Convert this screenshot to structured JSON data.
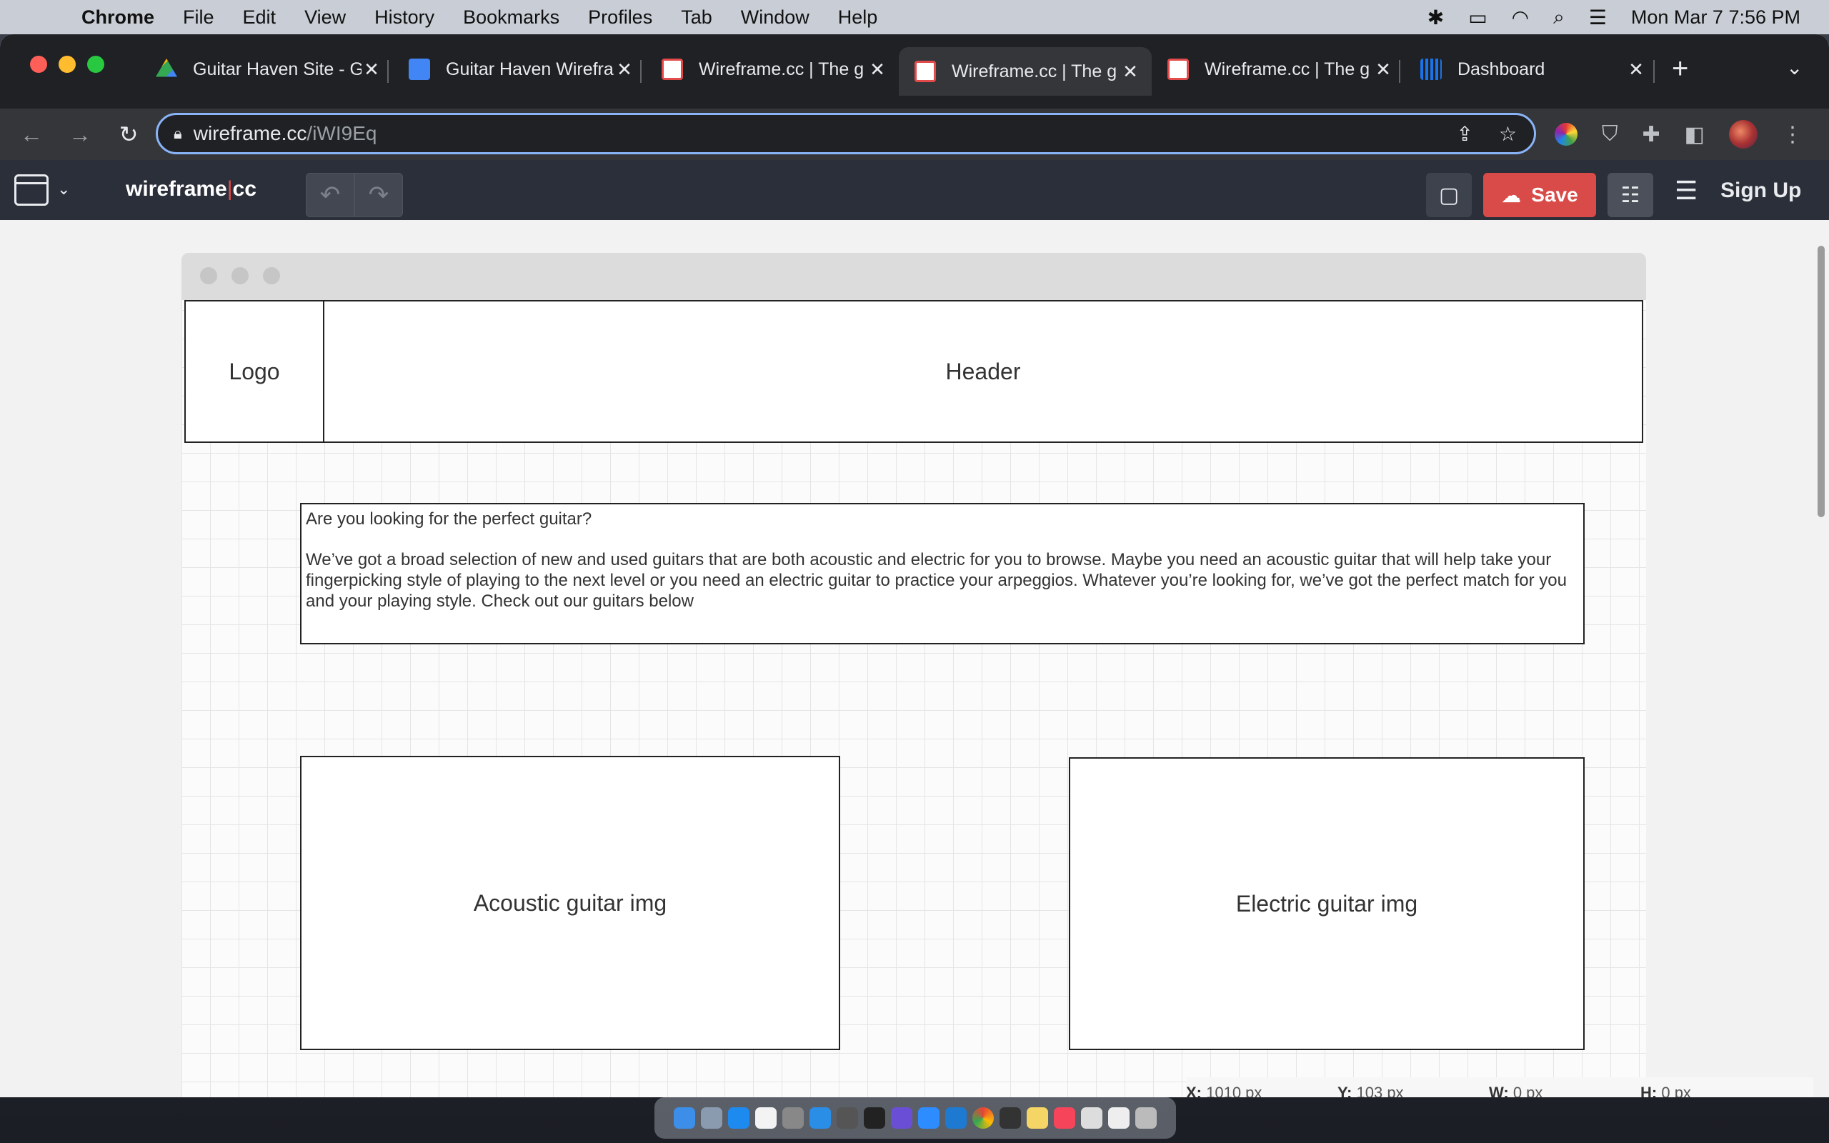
{
  "menubar": {
    "app": "Chrome",
    "items": [
      "File",
      "Edit",
      "View",
      "History",
      "Bookmarks",
      "Profiles",
      "Tab",
      "Window",
      "Help"
    ],
    "clock": "Mon Mar 7  7:56 PM"
  },
  "tabs": [
    {
      "title": "Guitar Haven Site - G",
      "icon": "drive-icon",
      "color": "#34a853"
    },
    {
      "title": "Guitar Haven Wirefra",
      "icon": "docs-icon",
      "color": "#4285f4"
    },
    {
      "title": "Wireframe.cc | The g",
      "icon": "wireframe-icon",
      "color": "#e34b4b"
    },
    {
      "title": "Wireframe.cc | The g",
      "icon": "wireframe-icon",
      "color": "#e34b4b"
    },
    {
      "title": "Wireframe.cc | The g",
      "icon": "wireframe-icon",
      "color": "#e34b4b"
    },
    {
      "title": "Dashboard",
      "icon": "analytics-icon",
      "color": "#1a73e8"
    }
  ],
  "address": {
    "host": "wireframe.cc",
    "path": "/iWI9Eq"
  },
  "app": {
    "brand_left": "wireframe",
    "brand_right": "cc",
    "save_label": "Save",
    "signup_label": "Sign Up",
    "accent": "#d94b48"
  },
  "wireframe": {
    "logo": "Logo",
    "header": "Header",
    "intro_heading": "Are you looking for the perfect guitar?",
    "intro_body": "We’ve got a broad selection of new and used guitars that are both acoustic and electric for you to browse. Maybe you need an acoustic guitar that will help take your fingerpicking style of playing to the next level or you need an electric guitar to practice your arpeggios. Whatever you’re looking for, we’ve got the perfect match for you and your playing style. Check out our guitars below",
    "acoustic": "Acoustic guitar img",
    "electric": "Electric guitar img"
  },
  "coords": {
    "x_label": "X:",
    "x_value": "1010 px",
    "y_label": "Y:",
    "y_value": "103 px",
    "w_label": "W:",
    "w_value": "0 px",
    "h_label": "H:",
    "h_value": "0 px"
  }
}
